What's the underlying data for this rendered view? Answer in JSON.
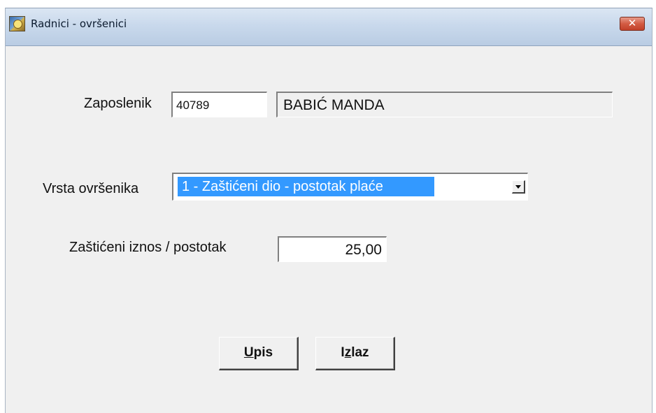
{
  "window": {
    "title": "Radnici - ovršenici",
    "close_label": "✕"
  },
  "employee": {
    "label": "Zaposlenik",
    "id_value": "40789",
    "name_value": "BABIĆ MANDA"
  },
  "debtor_type": {
    "label": "Vrsta ovršenika",
    "selected_option": "1 - Zaštićeni dio - postotak plaće"
  },
  "protected_amount": {
    "label": "Zaštićeni iznos / postotak",
    "value": "25,00"
  },
  "buttons": {
    "save": {
      "label": "Upis",
      "mnemonic": "U",
      "rest": "pis"
    },
    "exit": {
      "label": "Izlaz",
      "mnemonic_pre": "I",
      "mnemonic": "z",
      "rest": "laz"
    }
  },
  "colors": {
    "selection": "#3399ff",
    "window_bg": "#f0f0f0",
    "close_button": "#c2402a"
  }
}
